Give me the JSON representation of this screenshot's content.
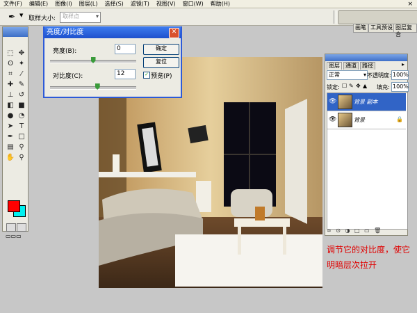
{
  "menu": {
    "items": [
      "文件(F)",
      "编辑(E)",
      "图像(I)",
      "图层(L)",
      "选择(S)",
      "滤镜(T)",
      "视图(V)",
      "窗口(W)",
      "帮助(H)"
    ],
    "close": "×"
  },
  "options_bar": {
    "sample_size_label": "取样大小:",
    "sample_size_value": "取样点",
    "well_tabs": [
      "画笔",
      "工具预设",
      "图层复合"
    ]
  },
  "toolbox": {
    "foreground_color": "#ff0000",
    "background_color": "#00ffff"
  },
  "dialog": {
    "title": "亮度/对比度",
    "brightness_label": "亮度(B):",
    "brightness_value": "0",
    "contrast_label": "对比度(C):",
    "contrast_value": "12",
    "ok_label": "确定",
    "reset_label": "复位",
    "preview_label": "预览(P)",
    "preview_checked": true,
    "brightness_level": 0.5,
    "contrast_level": 0.55
  },
  "layers_panel": {
    "tabs": [
      "图层",
      "通道",
      "路径"
    ],
    "blend_mode": "正常",
    "opacity_label": "不透明度:",
    "opacity_value": "100%",
    "lock_label": "锁定:",
    "fill_label": "填充:",
    "fill_value": "100%",
    "layers": [
      {
        "name": "背景 副本",
        "selected": true
      },
      {
        "name": "背景",
        "selected": false,
        "locked": true
      }
    ]
  },
  "annotation": {
    "line1": "调节它的对比度，使它",
    "line2": "明暗层次拉开"
  },
  "colors": {
    "title_bar": "#1e50cc",
    "annotation_text": "#e00000",
    "selected_layer": "#3164c6"
  }
}
